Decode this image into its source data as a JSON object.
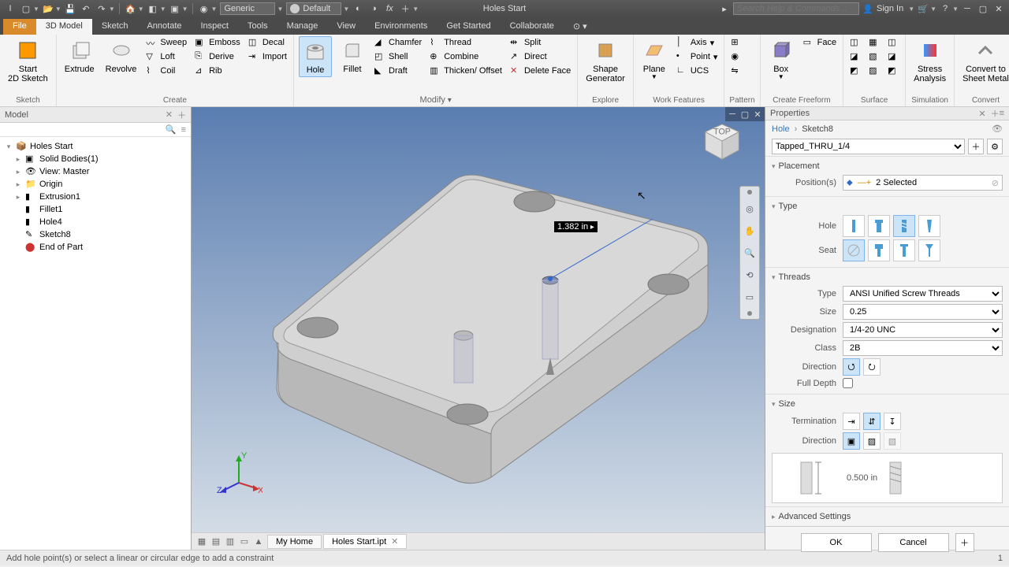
{
  "app": {
    "doc_title": "Holes Start",
    "search_placeholder": "Search Help & Commands...",
    "sign_in": "Sign In"
  },
  "tabs": {
    "file": "File",
    "items": [
      "3D Model",
      "Sketch",
      "Annotate",
      "Inspect",
      "Tools",
      "Manage",
      "View",
      "Environments",
      "Get Started",
      "Collaborate"
    ],
    "active": 0
  },
  "material": {
    "generic": "Generic",
    "appearance": "Default"
  },
  "ribbon": {
    "sketch": {
      "start": "Start\n2D Sketch",
      "title": "Sketch"
    },
    "create": {
      "extrude": "Extrude",
      "revolve": "Revolve",
      "sweep": "Sweep",
      "loft": "Loft",
      "coil": "Coil",
      "emboss": "Emboss",
      "derive": "Derive",
      "rib": "Rib",
      "decal": "Decal",
      "import": "Import",
      "title": "Create"
    },
    "modify": {
      "hole": "Hole",
      "fillet": "Fillet",
      "chamfer": "Chamfer",
      "shell": "Shell",
      "draft": "Draft",
      "thread": "Thread",
      "combine": "Combine",
      "thicken": "Thicken/ Offset",
      "split": "Split",
      "direct": "Direct",
      "delete_face": "Delete Face",
      "title": "Modify"
    },
    "explore": {
      "shape_gen": "Shape\nGenerator",
      "title": "Explore"
    },
    "work": {
      "plane": "Plane",
      "axis": "Axis",
      "point": "Point",
      "ucs": "UCS",
      "title": "Work Features"
    },
    "pattern": {
      "title": "Pattern"
    },
    "freeform": {
      "box": "Box",
      "face": "Face",
      "title": "Create Freeform"
    },
    "surface": {
      "title": "Surface"
    },
    "sim": {
      "stress": "Stress\nAnalysis",
      "title": "Simulation"
    },
    "convert": {
      "sheet": "Convert to\nSheet Metal",
      "title": "Convert"
    }
  },
  "browser": {
    "title": "Model",
    "root": "Holes Start",
    "items": [
      {
        "label": "Solid Bodies(1)",
        "icon": "cube"
      },
      {
        "label": "View: Master",
        "icon": "view"
      },
      {
        "label": "Origin",
        "icon": "folder"
      },
      {
        "label": "Extrusion1",
        "icon": "feat"
      },
      {
        "label": "Fillet1",
        "icon": "feat"
      },
      {
        "label": "Hole4",
        "icon": "feat"
      },
      {
        "label": "Sketch8",
        "icon": "sketch"
      },
      {
        "label": "End of Part",
        "icon": "end"
      }
    ]
  },
  "viewport": {
    "dimension": "1.382 in"
  },
  "doctabs": {
    "home": "My Home",
    "file": "Holes Start.ipt"
  },
  "props": {
    "title": "Properties",
    "crumb_hole": "Hole",
    "crumb_sketch": "Sketch8",
    "preset": "Tapped_THRU_1/4",
    "placement": "Placement",
    "positions_lbl": "Position(s)",
    "positions_val": "2 Selected",
    "type": "Type",
    "hole_lbl": "Hole",
    "seat_lbl": "Seat",
    "threads": "Threads",
    "thr_type_lbl": "Type",
    "thr_type_val": "ANSI Unified Screw Threads",
    "thr_size_lbl": "Size",
    "thr_size_val": "0.25",
    "thr_desig_lbl": "Designation",
    "thr_desig_val": "1/4-20 UNC",
    "thr_class_lbl": "Class",
    "thr_class_val": "2B",
    "thr_dir_lbl": "Direction",
    "full_depth": "Full Depth",
    "size": "Size",
    "term_lbl": "Termination",
    "dir_lbl": "Direction",
    "depth_val": "0.500 in",
    "advanced": "Advanced Settings",
    "ok": "OK",
    "cancel": "Cancel"
  },
  "status": {
    "msg": "Add hole point(s) or select a linear or circular edge to add a constraint",
    "right": "1"
  }
}
